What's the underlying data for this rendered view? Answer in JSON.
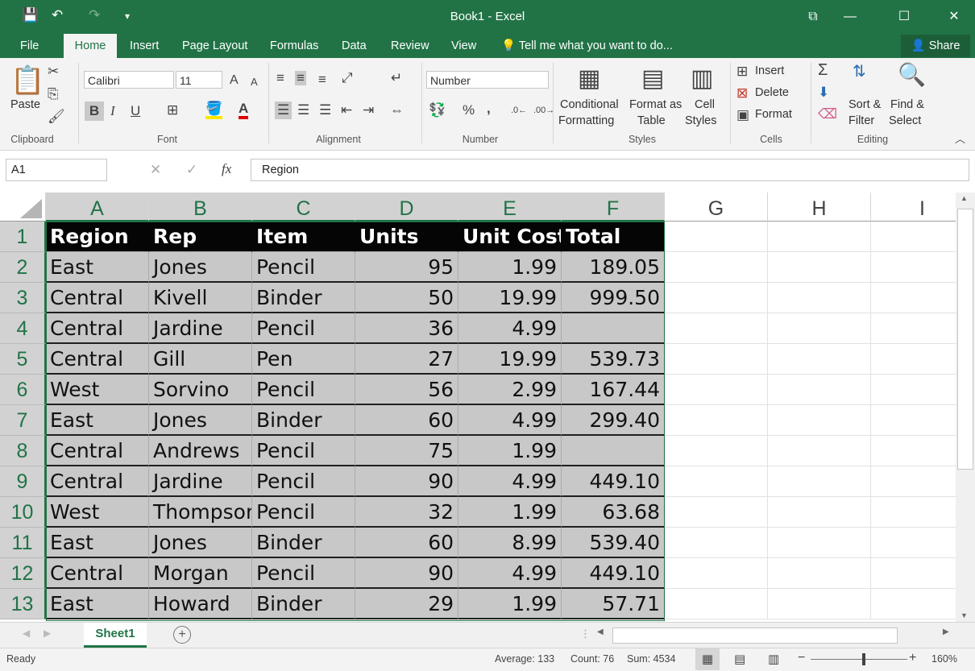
{
  "window": {
    "title": "Book1 - Excel",
    "minimize": "—",
    "maximize": "☐",
    "close": "✕",
    "ribbon_display": "⧉"
  },
  "quick_access": {
    "save": "💾",
    "undo": "↶",
    "redo": "↷",
    "customize": "▾"
  },
  "tabs": [
    "File",
    "Home",
    "Insert",
    "Page Layout",
    "Formulas",
    "Data",
    "Review",
    "View"
  ],
  "tell_me": "Tell me what you want to do...",
  "share": "Share",
  "ribbon": {
    "clipboard": {
      "label": "Clipboard",
      "paste": "Paste"
    },
    "font": {
      "label": "Font",
      "name": "Calibri",
      "size": "11",
      "grow": "A",
      "shrink": "A",
      "bold": "B",
      "italic": "I",
      "underline": "U"
    },
    "alignment": {
      "label": "Alignment"
    },
    "number": {
      "label": "Number",
      "format": "Number",
      "percent": "%",
      "comma": ","
    },
    "styles": {
      "label": "Styles",
      "conditional_1": "Conditional",
      "conditional_2": "Formatting",
      "format_as_1": "Format as",
      "format_as_2": "Table",
      "cell_1": "Cell",
      "cell_2": "Styles"
    },
    "cells": {
      "label": "Cells",
      "insert": "Insert",
      "delete": "Delete",
      "format": "Format"
    },
    "editing": {
      "label": "Editing",
      "sort_1": "Sort &",
      "sort_2": "Filter",
      "find_1": "Find &",
      "find_2": "Select"
    }
  },
  "formula_bar": {
    "name_box": "A1",
    "content": "Region",
    "fx": "fx",
    "cancel": "✕",
    "enter": "✓"
  },
  "columns": [
    "A",
    "B",
    "C",
    "D",
    "E",
    "F",
    "G",
    "H",
    "I"
  ],
  "rows": [
    "1",
    "2",
    "3",
    "4",
    "5",
    "6",
    "7",
    "8",
    "9",
    "10",
    "11",
    "12",
    "13"
  ],
  "table": {
    "headers": [
      "Region",
      "Rep",
      "Item",
      "Units",
      "Unit Cost",
      "Total"
    ],
    "rows": [
      [
        "East",
        "Jones",
        "Pencil",
        "95",
        "1.99",
        "189.05"
      ],
      [
        "Central",
        "Kivell",
        "Binder",
        "50",
        "19.99",
        "999.50"
      ],
      [
        "Central",
        "Jardine",
        "Pencil",
        "36",
        "4.99",
        ""
      ],
      [
        "Central",
        "Gill",
        "Pen",
        "27",
        "19.99",
        "539.73"
      ],
      [
        "West",
        "Sorvino",
        "Pencil",
        "56",
        "2.99",
        "167.44"
      ],
      [
        "East",
        "Jones",
        "Binder",
        "60",
        "4.99",
        "299.40"
      ],
      [
        "Central",
        "Andrews",
        "Pencil",
        "75",
        "1.99",
        ""
      ],
      [
        "Central",
        "Jardine",
        "Pencil",
        "90",
        "4.99",
        "449.10"
      ],
      [
        "West",
        "Thompson",
        "Pencil",
        "32",
        "1.99",
        "63.68"
      ],
      [
        "East",
        "Jones",
        "Binder",
        "60",
        "8.99",
        "539.40"
      ],
      [
        "Central",
        "Morgan",
        "Pencil",
        "90",
        "4.99",
        "449.10"
      ],
      [
        "East",
        "Howard",
        "Binder",
        "29",
        "1.99",
        "57.71"
      ]
    ]
  },
  "sheet_tab": "Sheet1",
  "add_sheet": "+",
  "status": {
    "ready": "Ready",
    "average": "Average: 133",
    "count": "Count: 76",
    "sum": "Sum: 4534",
    "zoom": "160%",
    "zoom_minus": "−",
    "zoom_plus": "+"
  }
}
